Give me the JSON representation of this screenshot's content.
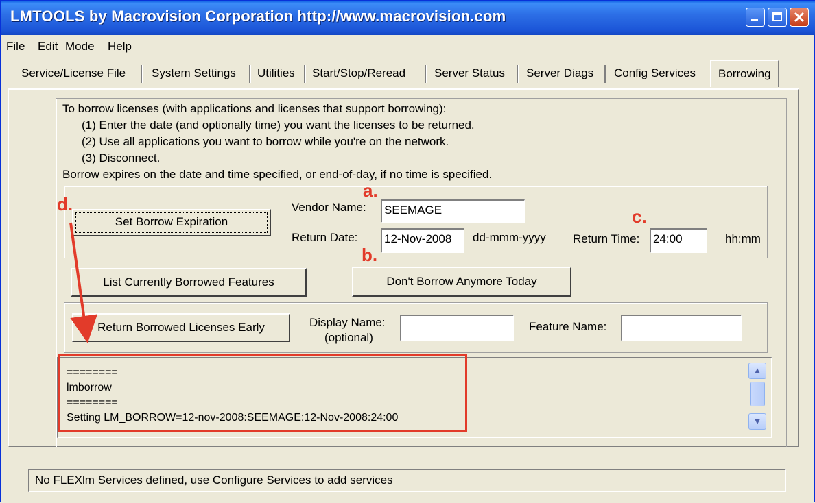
{
  "window": {
    "title": "LMTOOLS by Macrovision Corporation http://www.macrovision.com"
  },
  "menu": [
    "File",
    "Edit",
    "Mode",
    "Help"
  ],
  "tabs": [
    "Service/License File",
    "System Settings",
    "Utilities",
    "Start/Stop/Reread",
    "Server Status",
    "Server Diags",
    "Config Services",
    "Borrowing"
  ],
  "active_tab": "Borrowing",
  "instructions": {
    "line0": "To borrow licenses (with applications and licenses that support borrowing):",
    "line1": "(1) Enter the date (and optionally time) you want the licenses to be returned.",
    "line2": "(2) Use all applications you want to borrow while you're on the network.",
    "line3": "(3) Disconnect.",
    "line4": "Borrow expires on the date and time specified, or end-of-day, if no time is specified."
  },
  "borrow": {
    "set_button": "Set Borrow Expiration",
    "vendor_label": "Vendor Name:",
    "vendor_value": "SEEMAGE",
    "return_date_label": "Return Date:",
    "return_date_value": "12-Nov-2008",
    "date_format": "dd-mmm-yyyy",
    "return_time_label": "Return Time:",
    "return_time_value": "24:00",
    "time_format": "hh:mm"
  },
  "actions": {
    "list_button": "List Currently Borrowed Features",
    "dont_borrow_button": "Don't Borrow Anymore Today"
  },
  "return_group": {
    "return_button": "Return Borrowed Licenses Early",
    "display_label_1": "Display Name:",
    "display_label_2": "(optional)",
    "display_value": "",
    "feature_label": "Feature Name:",
    "feature_value": ""
  },
  "output_lines": [
    "========",
    "lmborrow",
    "========",
    "Setting LM_BORROW=12-nov-2008:SEEMAGE:12-Nov-2008:24:00"
  ],
  "annotations": {
    "a": "a.",
    "b": "b.",
    "c": "c.",
    "d": "d."
  },
  "annotation_color": "#e23b2a",
  "status_text": "No FLEXlm Services defined, use Configure Services to add services"
}
